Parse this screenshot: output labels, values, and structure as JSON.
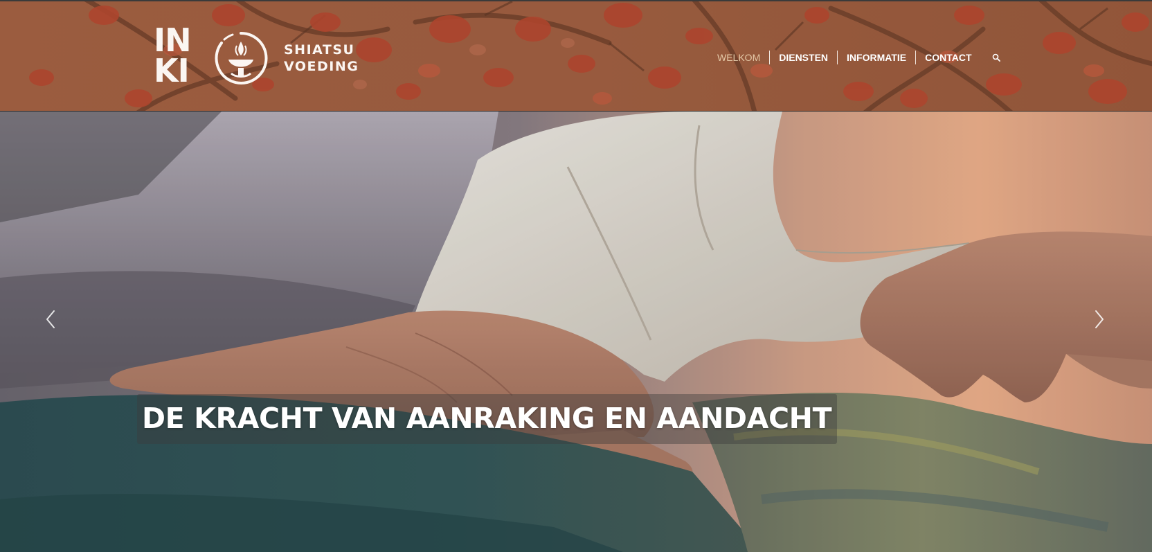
{
  "header": {
    "logo": {
      "line1": "IN",
      "line2": "KI",
      "word1": "SHIATSU",
      "word2": "VOEDING"
    },
    "nav": {
      "items": [
        {
          "label": "WELKOM",
          "active": true
        },
        {
          "label": "DIENSTEN",
          "active": false
        },
        {
          "label": "INFORMATIE",
          "active": false
        },
        {
          "label": "CONTACT",
          "active": false
        }
      ],
      "search_icon": "search-icon"
    },
    "colors": {
      "header_bg": "#9a5a3f",
      "blossom": "#b8402a",
      "active_nav": "#e4c9a7"
    }
  },
  "hero": {
    "caption": "DE KRACHT VAN AANRAKING EN AANDACHT",
    "prev_icon": "chevron-left-icon",
    "next_icon": "chevron-right-icon"
  }
}
